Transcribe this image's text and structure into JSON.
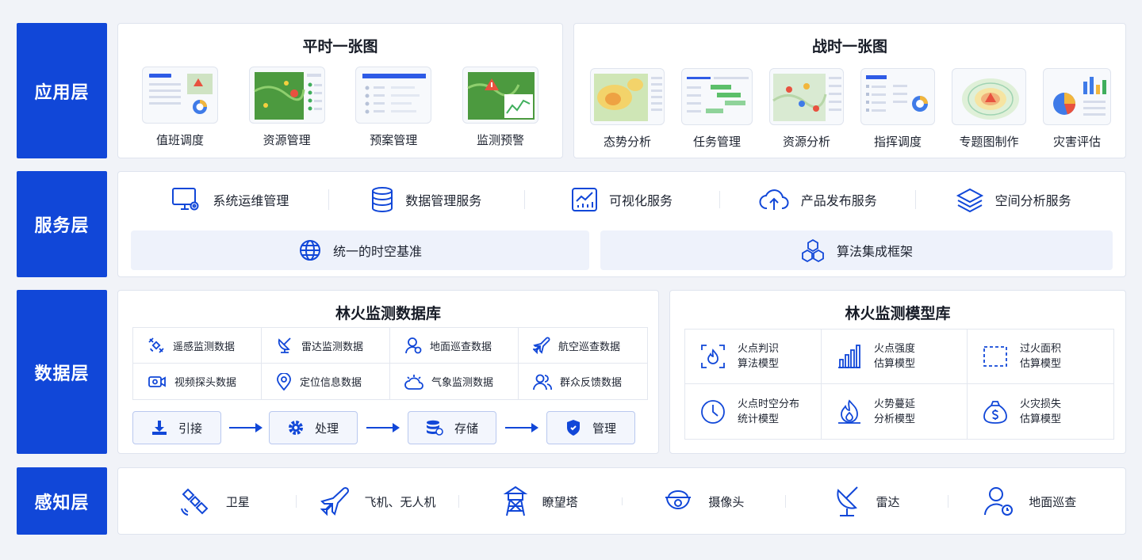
{
  "layers": {
    "app": "应用层",
    "service": "服务层",
    "data": "数据层",
    "sensing": "感知层"
  },
  "app": {
    "peace": {
      "title": "平时一张图",
      "items": [
        {
          "label": "值班调度",
          "icon": "dashboard-thumbnail"
        },
        {
          "label": "资源管理",
          "icon": "map-thumbnail"
        },
        {
          "label": "预案管理",
          "icon": "form-thumbnail"
        },
        {
          "label": "监测预警",
          "icon": "warning-map-thumbnail"
        }
      ]
    },
    "war": {
      "title": "战时一张图",
      "items": [
        {
          "label": "态势分析",
          "icon": "heatmap-thumbnail"
        },
        {
          "label": "任务管理",
          "icon": "gantt-thumbnail"
        },
        {
          "label": "资源分析",
          "icon": "map-pins-thumbnail"
        },
        {
          "label": "指挥调度",
          "icon": "dashboard-thumbnail"
        },
        {
          "label": "专题图制作",
          "icon": "contour-map-thumbnail"
        },
        {
          "label": "灾害评估",
          "icon": "charts-thumbnail"
        }
      ]
    }
  },
  "service": {
    "items": [
      {
        "label": "系统运维管理",
        "icon": "monitor-gear-icon"
      },
      {
        "label": "数据管理服务",
        "icon": "database-icon"
      },
      {
        "label": "可视化服务",
        "icon": "chart-icon"
      },
      {
        "label": "产品发布服务",
        "icon": "cloud-upload-icon"
      },
      {
        "label": "空间分析服务",
        "icon": "layers-icon"
      }
    ],
    "base": {
      "label": "统一的时空基准",
      "icon": "globe-icon"
    },
    "framework": {
      "label": "算法集成框架",
      "icon": "cubes-icon"
    }
  },
  "data": {
    "db": {
      "title": "林火监测数据库",
      "items": [
        {
          "label": "遥感监测数据",
          "icon": "satellite-icon"
        },
        {
          "label": "雷达监测数据",
          "icon": "radar-icon"
        },
        {
          "label": "地面巡查数据",
          "icon": "person-icon"
        },
        {
          "label": "航空巡查数据",
          "icon": "plane-icon"
        },
        {
          "label": "视频探头数据",
          "icon": "video-icon"
        },
        {
          "label": "定位信息数据",
          "icon": "location-icon"
        },
        {
          "label": "气象监测数据",
          "icon": "weather-icon"
        },
        {
          "label": "群众反馈数据",
          "icon": "people-icon"
        }
      ],
      "flow": [
        {
          "label": "引接",
          "icon": "download-icon"
        },
        {
          "label": "处理",
          "icon": "gear-icon"
        },
        {
          "label": "存储",
          "icon": "storage-icon"
        },
        {
          "label": "管理",
          "icon": "shield-icon"
        }
      ]
    },
    "models": {
      "title": "林火监测模型库",
      "items": [
        {
          "line1": "火点判识",
          "line2": "算法模型",
          "icon": "fire-scan-icon"
        },
        {
          "line1": "火点强度",
          "line2": "估算模型",
          "icon": "bar-chart-icon"
        },
        {
          "line1": "过火面积",
          "line2": "估算模型",
          "icon": "dashed-area-icon"
        },
        {
          "line1": "火点时空分布",
          "line2": "统计模型",
          "icon": "clock-icon"
        },
        {
          "line1": "火势蔓延",
          "line2": "分析模型",
          "icon": "flame-icon"
        },
        {
          "line1": "火灾损失",
          "line2": "估算模型",
          "icon": "money-bag-icon"
        }
      ]
    }
  },
  "sensing": {
    "items": [
      {
        "label": "卫星",
        "icon": "satellite-icon"
      },
      {
        "label": "飞机、无人机",
        "icon": "plane-icon"
      },
      {
        "label": "瞭望塔",
        "icon": "tower-icon"
      },
      {
        "label": "摄像头",
        "icon": "camera-icon"
      },
      {
        "label": "雷达",
        "icon": "radar-icon"
      },
      {
        "label": "地面巡查",
        "icon": "person-icon"
      }
    ]
  },
  "colors": {
    "accent": "#1147d8",
    "panel_border": "#dfe4ee",
    "soft_fill": "#eef2fb"
  }
}
